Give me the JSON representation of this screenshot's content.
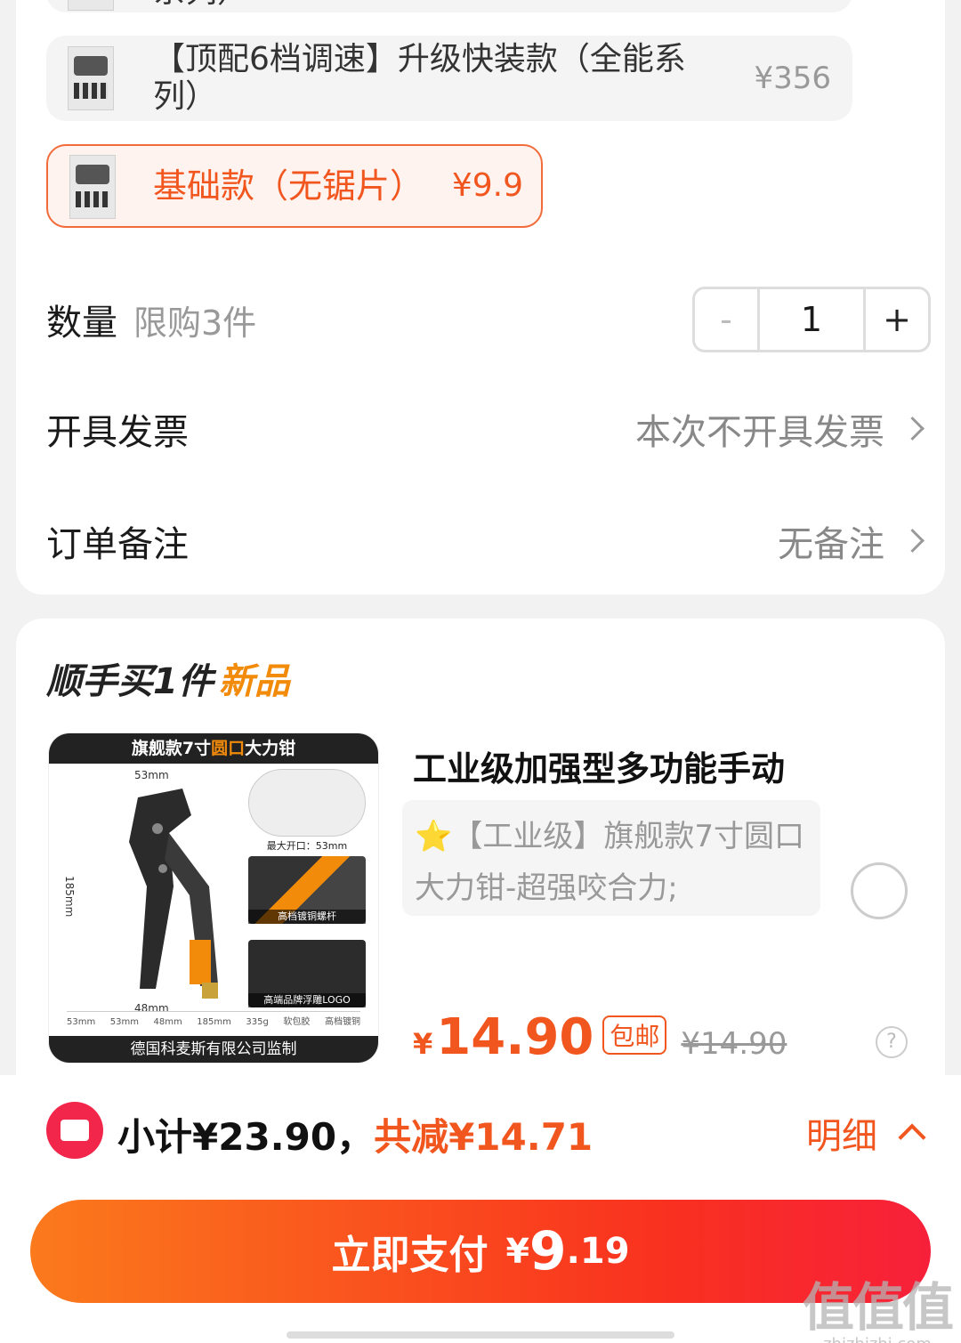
{
  "variants": [
    {
      "name": "系列）",
      "price": ""
    },
    {
      "name": "【顶配6档调速】升级快装款（全能系列）",
      "price": "¥356"
    },
    {
      "name": "基础款（无锯片）",
      "price": "¥9.9",
      "selected": true
    }
  ],
  "quantity": {
    "label": "数量",
    "limit": "限购3件",
    "value": "1",
    "minus": "-",
    "plus": "+"
  },
  "invoice": {
    "label": "开具发票",
    "value": "本次不开具发票"
  },
  "remark": {
    "label": "订单备注",
    "value": "无备注"
  },
  "bundle": {
    "title": "顺手买1件",
    "tag": "新品",
    "product": {
      "title": "工业级加强型多功能手动",
      "star": "⭐",
      "desc": "【工业级】旗舰款7寸圆口大力钳-超强咬合力;",
      "price_symbol": "¥",
      "price": "14.90",
      "shipping": "包邮",
      "original_price": "¥14.90",
      "help": "?",
      "image": {
        "banner_pre": "旗舰款7寸",
        "banner_hl": "圆口",
        "banner_post": "大力钳",
        "dim_top": "53mm",
        "dim_left": "185mm",
        "dim_bottom": "48mm",
        "cap1": "最大开口：53mm",
        "cap2": "高档镀铜螺杆",
        "cap3": "高端品牌浮雕LOGO",
        "specs": [
          "53mm",
          "53mm",
          "48mm",
          "185mm",
          "335g",
          "软包胶",
          "高档镀铜"
        ],
        "footer": "德国科麦斯有限公司监制"
      }
    }
  },
  "summary": {
    "subtotal": "小计¥23.90，",
    "discount": "共减¥14.71",
    "detail": "明细"
  },
  "pay": {
    "label": "立即支付",
    "symbol": "¥",
    "int": "9",
    "dec": ".19"
  },
  "watermark": {
    "big": "值值值",
    "small": "zhizhizhi.com"
  },
  "colors": {
    "accent": "#f2561f",
    "pay_start": "#fb7a1c",
    "pay_end": "#f7203a"
  }
}
